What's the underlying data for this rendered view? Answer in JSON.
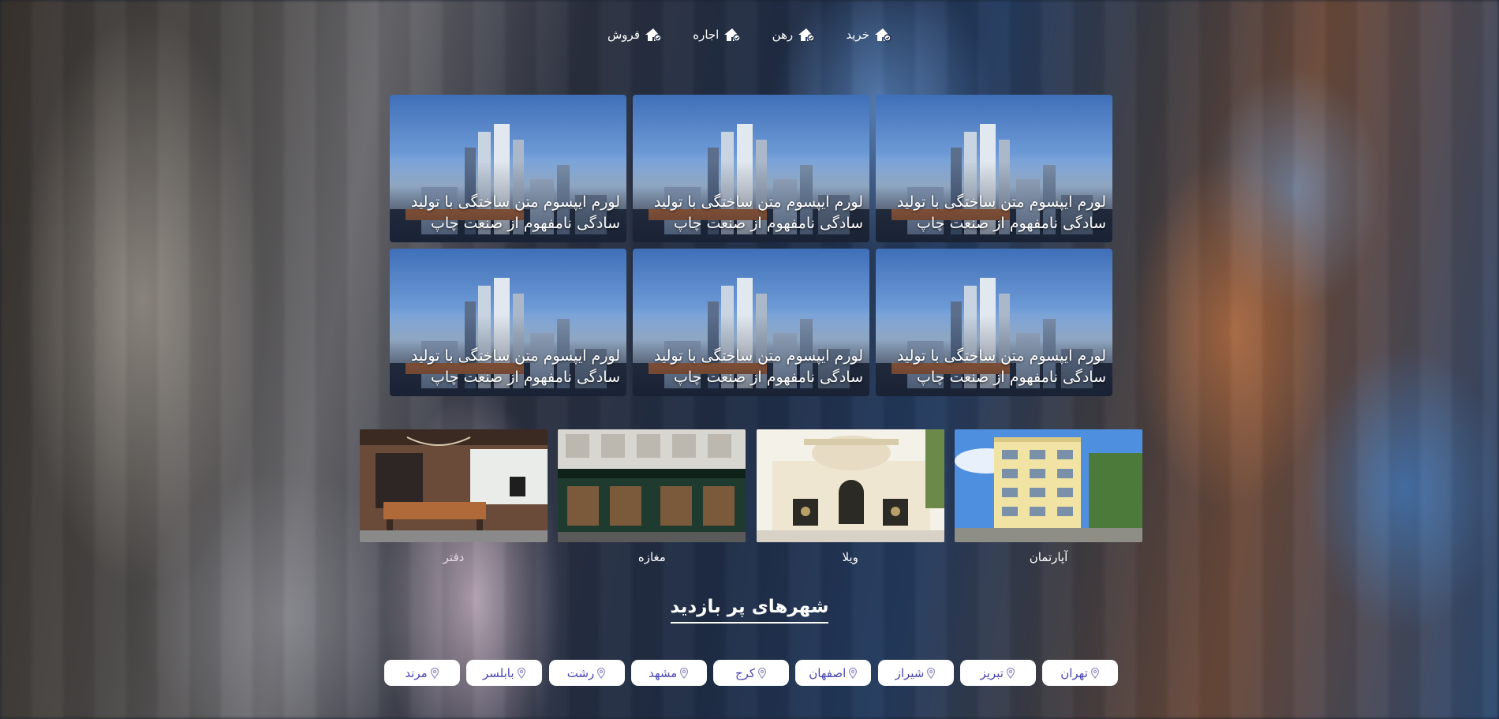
{
  "nav": {
    "items": [
      {
        "label": "خرید",
        "icon": "house-icon"
      },
      {
        "label": "رهن",
        "icon": "house-icon"
      },
      {
        "label": "اجاره",
        "icon": "house-icon"
      },
      {
        "label": "فروش",
        "icon": "house-icon"
      }
    ]
  },
  "featured": {
    "cards": [
      {
        "caption": "لورم ایپسوم متن ساختگی با تولید سادگی نامفهوم از صنعت چاپ"
      },
      {
        "caption": "لورم ایپسوم متن ساختگی با تولید سادگی نامفهوم از صنعت چاپ"
      },
      {
        "caption": "لورم ایپسوم متن ساختگی با تولید سادگی نامفهوم از صنعت چاپ"
      },
      {
        "caption": "لورم ایپسوم متن ساختگی با تولید سادگی نامفهوم از صنعت چاپ"
      },
      {
        "caption": "لورم ایپسوم متن ساختگی با تولید سادگی نامفهوم از صنعت چاپ"
      },
      {
        "caption": "لورم ایپسوم متن ساختگی با تولید سادگی نامفهوم از صنعت چاپ"
      }
    ]
  },
  "categories": [
    {
      "label": "آپارتمان"
    },
    {
      "label": "ویلا"
    },
    {
      "label": "مغازه"
    },
    {
      "label": "دفتر"
    }
  ],
  "popular_cities": {
    "title": "شهرهای پر بازدید",
    "items": [
      "تهران",
      "تبریز",
      "شیراز",
      "اصفهان",
      "کرج",
      "مشهد",
      "رشت",
      "بابلسر",
      "مرند"
    ]
  },
  "colors": {
    "city_text": "#4a46b0",
    "city_bg": "#ffffff"
  }
}
